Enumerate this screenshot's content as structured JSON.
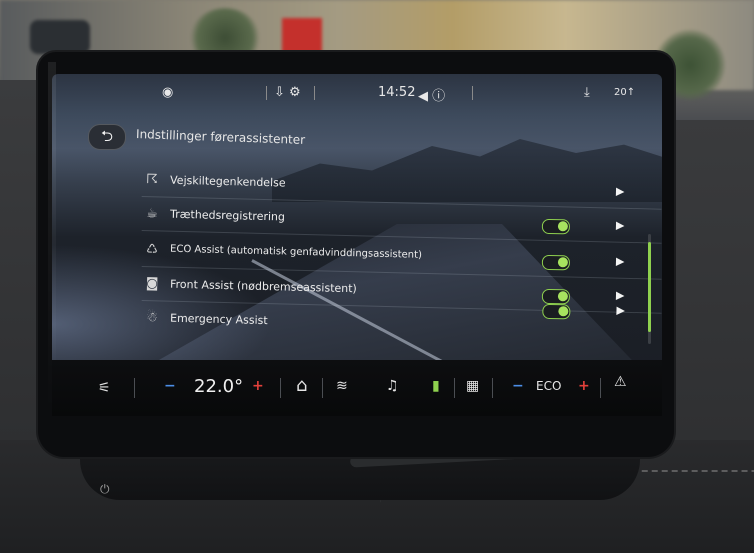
{
  "status_bar": {
    "left_icon": "settings-dot-icon",
    "center_icons": "⇩ ⚙",
    "time": "14:52",
    "audio_icons": "◀ ⓘ",
    "right_label": "20↑"
  },
  "header": {
    "back_symbol": "⮌",
    "title": "Indstillinger førerassistenter"
  },
  "rows": [
    {
      "label": "Vejskiltegenkendelse",
      "icon": "☈",
      "has_toggle": false
    },
    {
      "label": "Træthedsregistrering",
      "icon": "☕",
      "has_toggle": true
    },
    {
      "label": "ECO Assist (automatisk genfadvinddingsassistent)",
      "icon": "♺",
      "has_toggle": true
    },
    {
      "label": "Front Assist (nødbremseassistent)",
      "icon": "◙",
      "has_toggle": true
    },
    {
      "label": "Emergency Assist",
      "icon": "☃",
      "has_toggle": true
    }
  ],
  "bottom_bar": {
    "seat_icon": "⚟",
    "minus": "−",
    "temperature": "22.0°",
    "plus": "+",
    "home": "⌂",
    "fan": "≋",
    "music": "♫",
    "battery": "▮",
    "apps": "▦",
    "minus2": "−",
    "eco": "ECO",
    "plus2": "+",
    "seat2": "⚠"
  },
  "colors": {
    "accent_green": "#8fd14f",
    "hot_red": "#e2403a",
    "cold_blue": "#4c8ee6"
  }
}
